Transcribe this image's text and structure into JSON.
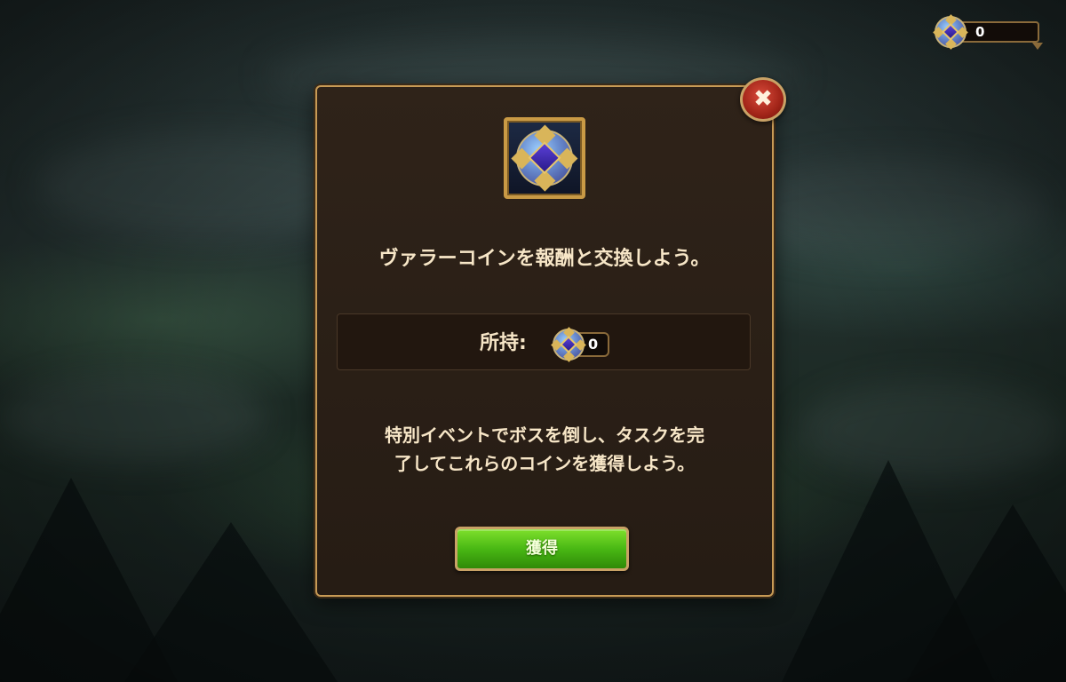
{
  "hud": {
    "coin_icon": "valor-coin-icon",
    "coin_count": "0"
  },
  "dialog": {
    "close_icon": "close-icon",
    "reward_icon": "valor-coin-icon",
    "headline": "ヴァラーコインを報酬と交換しよう。",
    "owned": {
      "label": "所持:",
      "count": "0"
    },
    "description_line1": "特別イベントでボスを倒し、タスクを完",
    "description_line2": "了してこれらのコインを獲得しよう。",
    "obtain_button": "獲得"
  },
  "colors": {
    "dialog_bg": "#2f2319",
    "dialog_border": "#c79a55",
    "text": "#f7e6c7",
    "button_green": "#49b814",
    "close_red": "#a12418"
  }
}
